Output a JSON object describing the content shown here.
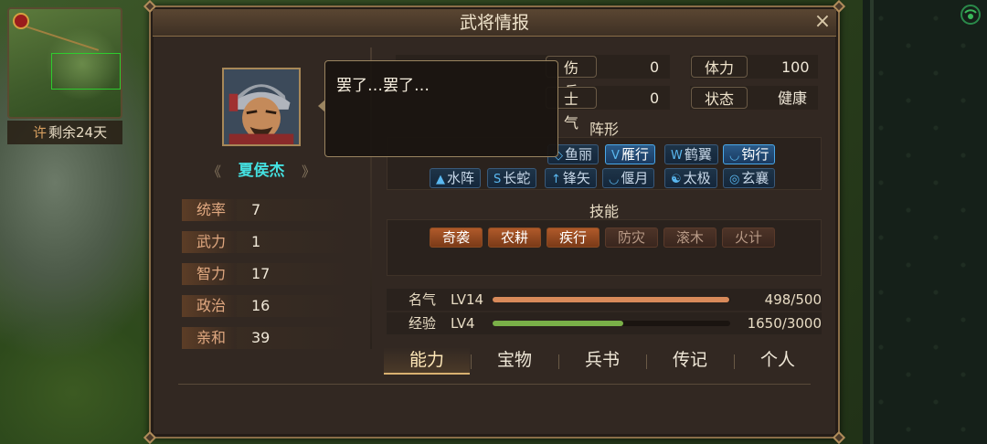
{
  "map": {
    "days_city": "许",
    "days_text": "剩余24天"
  },
  "dialog": {
    "title": "武将情报",
    "close_label": "×"
  },
  "general": {
    "name": "夏侯杰",
    "stats": [
      {
        "label": "统率",
        "value": "7"
      },
      {
        "label": "武力",
        "value": "1"
      },
      {
        "label": "智力",
        "value": "17"
      },
      {
        "label": "政治",
        "value": "16"
      },
      {
        "label": "亲和",
        "value": "39"
      }
    ]
  },
  "info": {
    "soldiers_label": "伤兵",
    "soldiers_value": "0",
    "stamina_label": "体力",
    "stamina_value": "100",
    "morale_label": "士气",
    "morale_value": "0",
    "status_label": "状态",
    "status_value": "健康"
  },
  "formations": {
    "title": "阵形",
    "items": [
      {
        "label": "鱼丽",
        "icon": "fish-formation-icon"
      },
      {
        "label": "雁行",
        "icon": "v-formation-icon"
      },
      {
        "label": "鹤翼",
        "icon": "wing-formation-icon"
      },
      {
        "label": "钩行",
        "icon": "hook-formation-icon"
      },
      {
        "label": "水阵",
        "icon": "water-formation-icon"
      },
      {
        "label": "长蛇",
        "icon": "snake-formation-icon"
      },
      {
        "label": "锋矢",
        "icon": "arrow-formation-icon"
      },
      {
        "label": "偃月",
        "icon": "crescent-formation-icon"
      },
      {
        "label": "太极",
        "icon": "taiji-formation-icon"
      },
      {
        "label": "玄襄",
        "icon": "xuanxiang-formation-icon"
      }
    ]
  },
  "skills": {
    "title": "技能",
    "items": [
      {
        "label": "奇袭",
        "learned": true
      },
      {
        "label": "农耕",
        "learned": true
      },
      {
        "label": "疾行",
        "learned": true
      },
      {
        "label": "防灾",
        "learned": false
      },
      {
        "label": "滚木",
        "learned": false
      },
      {
        "label": "火计",
        "learned": false
      }
    ]
  },
  "progress": {
    "fame": {
      "label": "名气",
      "level": "LV14",
      "value": "498/500",
      "fraction": 0.996,
      "color": "#d88a5a"
    },
    "exp": {
      "label": "经验",
      "level": "LV4",
      "value": "1650/3000",
      "fraction": 0.55,
      "color": "#7ab048"
    }
  },
  "tabs": [
    {
      "label": "能力",
      "active": true
    },
    {
      "label": "宝物",
      "active": false
    },
    {
      "label": "兵书",
      "active": false
    },
    {
      "label": "传记",
      "active": false
    },
    {
      "label": "个人",
      "active": false
    }
  ],
  "tooltip": {
    "text": "罢了…罢了…"
  },
  "colors": {
    "name": "#44e0e0",
    "active_formation": "#2a5a88",
    "skill_learned": "#b05a2a"
  }
}
